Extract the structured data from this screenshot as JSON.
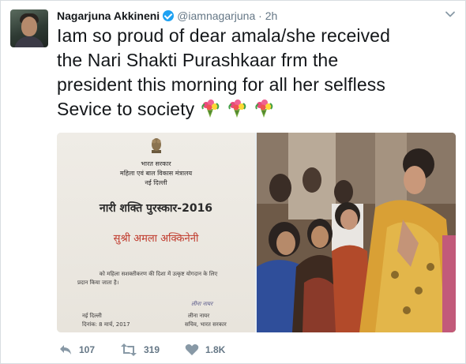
{
  "tweet": {
    "author_name": "Nagarjuna Akkineni",
    "handle": "@iamnagarjuna",
    "separator": "·",
    "time": "2h",
    "text_lines": [
      "Iam so proud of dear amala/she received",
      "the Nari Shakti Purashkaar frm the",
      "president this morning for all her selfless",
      "Sevice to society"
    ],
    "emoji": [
      "bouquet-icon",
      "bouquet-icon",
      "bouquet-icon"
    ]
  },
  "certificate": {
    "line1": "भारत सरकार",
    "line2": "महिला एवं बाल विकास मंत्रालय",
    "line3": "नई दिल्ली",
    "title": "नारी शक्ति पुरस्कार-2016",
    "recipient": "सुश्री अमला अक्किनेनी",
    "citation_1": "को महिला सशक्तीकरण की दिशा में उत्कृष्ट योगदान के लिए",
    "citation_2": "प्रदान किया जाता है।",
    "place": "नई दिल्ली",
    "date": "दिनांक: 8 मार्च, 2017",
    "signatory": "लीना नायर",
    "signatory_title": "सचिव, भारत सरकार"
  },
  "actions": {
    "reply_count": "107",
    "retweet_count": "319",
    "like_count": "1.8K"
  },
  "colors": {
    "accent": "#1da1f2",
    "text": "#14171a",
    "muted": "#657786",
    "recipient_red": "#c0392b"
  }
}
